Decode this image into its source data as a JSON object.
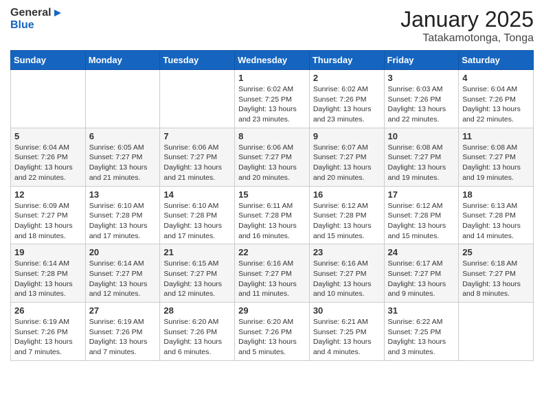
{
  "header": {
    "logo_general": "General",
    "logo_blue": "Blue",
    "month": "January 2025",
    "location": "Tatakamotonga, Tonga"
  },
  "weekdays": [
    "Sunday",
    "Monday",
    "Tuesday",
    "Wednesday",
    "Thursday",
    "Friday",
    "Saturday"
  ],
  "weeks": [
    [
      {
        "day": "",
        "sunrise": "",
        "sunset": "",
        "daylight": ""
      },
      {
        "day": "",
        "sunrise": "",
        "sunset": "",
        "daylight": ""
      },
      {
        "day": "",
        "sunrise": "",
        "sunset": "",
        "daylight": ""
      },
      {
        "day": "1",
        "sunrise": "Sunrise: 6:02 AM",
        "sunset": "Sunset: 7:25 PM",
        "daylight": "Daylight: 13 hours and 23 minutes."
      },
      {
        "day": "2",
        "sunrise": "Sunrise: 6:02 AM",
        "sunset": "Sunset: 7:26 PM",
        "daylight": "Daylight: 13 hours and 23 minutes."
      },
      {
        "day": "3",
        "sunrise": "Sunrise: 6:03 AM",
        "sunset": "Sunset: 7:26 PM",
        "daylight": "Daylight: 13 hours and 22 minutes."
      },
      {
        "day": "4",
        "sunrise": "Sunrise: 6:04 AM",
        "sunset": "Sunset: 7:26 PM",
        "daylight": "Daylight: 13 hours and 22 minutes."
      }
    ],
    [
      {
        "day": "5",
        "sunrise": "Sunrise: 6:04 AM",
        "sunset": "Sunset: 7:26 PM",
        "daylight": "Daylight: 13 hours and 22 minutes."
      },
      {
        "day": "6",
        "sunrise": "Sunrise: 6:05 AM",
        "sunset": "Sunset: 7:27 PM",
        "daylight": "Daylight: 13 hours and 21 minutes."
      },
      {
        "day": "7",
        "sunrise": "Sunrise: 6:06 AM",
        "sunset": "Sunset: 7:27 PM",
        "daylight": "Daylight: 13 hours and 21 minutes."
      },
      {
        "day": "8",
        "sunrise": "Sunrise: 6:06 AM",
        "sunset": "Sunset: 7:27 PM",
        "daylight": "Daylight: 13 hours and 20 minutes."
      },
      {
        "day": "9",
        "sunrise": "Sunrise: 6:07 AM",
        "sunset": "Sunset: 7:27 PM",
        "daylight": "Daylight: 13 hours and 20 minutes."
      },
      {
        "day": "10",
        "sunrise": "Sunrise: 6:08 AM",
        "sunset": "Sunset: 7:27 PM",
        "daylight": "Daylight: 13 hours and 19 minutes."
      },
      {
        "day": "11",
        "sunrise": "Sunrise: 6:08 AM",
        "sunset": "Sunset: 7:27 PM",
        "daylight": "Daylight: 13 hours and 19 minutes."
      }
    ],
    [
      {
        "day": "12",
        "sunrise": "Sunrise: 6:09 AM",
        "sunset": "Sunset: 7:27 PM",
        "daylight": "Daylight: 13 hours and 18 minutes."
      },
      {
        "day": "13",
        "sunrise": "Sunrise: 6:10 AM",
        "sunset": "Sunset: 7:28 PM",
        "daylight": "Daylight: 13 hours and 17 minutes."
      },
      {
        "day": "14",
        "sunrise": "Sunrise: 6:10 AM",
        "sunset": "Sunset: 7:28 PM",
        "daylight": "Daylight: 13 hours and 17 minutes."
      },
      {
        "day": "15",
        "sunrise": "Sunrise: 6:11 AM",
        "sunset": "Sunset: 7:28 PM",
        "daylight": "Daylight: 13 hours and 16 minutes."
      },
      {
        "day": "16",
        "sunrise": "Sunrise: 6:12 AM",
        "sunset": "Sunset: 7:28 PM",
        "daylight": "Daylight: 13 hours and 15 minutes."
      },
      {
        "day": "17",
        "sunrise": "Sunrise: 6:12 AM",
        "sunset": "Sunset: 7:28 PM",
        "daylight": "Daylight: 13 hours and 15 minutes."
      },
      {
        "day": "18",
        "sunrise": "Sunrise: 6:13 AM",
        "sunset": "Sunset: 7:28 PM",
        "daylight": "Daylight: 13 hours and 14 minutes."
      }
    ],
    [
      {
        "day": "19",
        "sunrise": "Sunrise: 6:14 AM",
        "sunset": "Sunset: 7:28 PM",
        "daylight": "Daylight: 13 hours and 13 minutes."
      },
      {
        "day": "20",
        "sunrise": "Sunrise: 6:14 AM",
        "sunset": "Sunset: 7:27 PM",
        "daylight": "Daylight: 13 hours and 12 minutes."
      },
      {
        "day": "21",
        "sunrise": "Sunrise: 6:15 AM",
        "sunset": "Sunset: 7:27 PM",
        "daylight": "Daylight: 13 hours and 12 minutes."
      },
      {
        "day": "22",
        "sunrise": "Sunrise: 6:16 AM",
        "sunset": "Sunset: 7:27 PM",
        "daylight": "Daylight: 13 hours and 11 minutes."
      },
      {
        "day": "23",
        "sunrise": "Sunrise: 6:16 AM",
        "sunset": "Sunset: 7:27 PM",
        "daylight": "Daylight: 13 hours and 10 minutes."
      },
      {
        "day": "24",
        "sunrise": "Sunrise: 6:17 AM",
        "sunset": "Sunset: 7:27 PM",
        "daylight": "Daylight: 13 hours and 9 minutes."
      },
      {
        "day": "25",
        "sunrise": "Sunrise: 6:18 AM",
        "sunset": "Sunset: 7:27 PM",
        "daylight": "Daylight: 13 hours and 8 minutes."
      }
    ],
    [
      {
        "day": "26",
        "sunrise": "Sunrise: 6:19 AM",
        "sunset": "Sunset: 7:26 PM",
        "daylight": "Daylight: 13 hours and 7 minutes."
      },
      {
        "day": "27",
        "sunrise": "Sunrise: 6:19 AM",
        "sunset": "Sunset: 7:26 PM",
        "daylight": "Daylight: 13 hours and 7 minutes."
      },
      {
        "day": "28",
        "sunrise": "Sunrise: 6:20 AM",
        "sunset": "Sunset: 7:26 PM",
        "daylight": "Daylight: 13 hours and 6 minutes."
      },
      {
        "day": "29",
        "sunrise": "Sunrise: 6:20 AM",
        "sunset": "Sunset: 7:26 PM",
        "daylight": "Daylight: 13 hours and 5 minutes."
      },
      {
        "day": "30",
        "sunrise": "Sunrise: 6:21 AM",
        "sunset": "Sunset: 7:25 PM",
        "daylight": "Daylight: 13 hours and 4 minutes."
      },
      {
        "day": "31",
        "sunrise": "Sunrise: 6:22 AM",
        "sunset": "Sunset: 7:25 PM",
        "daylight": "Daylight: 13 hours and 3 minutes."
      },
      {
        "day": "",
        "sunrise": "",
        "sunset": "",
        "daylight": ""
      }
    ]
  ]
}
